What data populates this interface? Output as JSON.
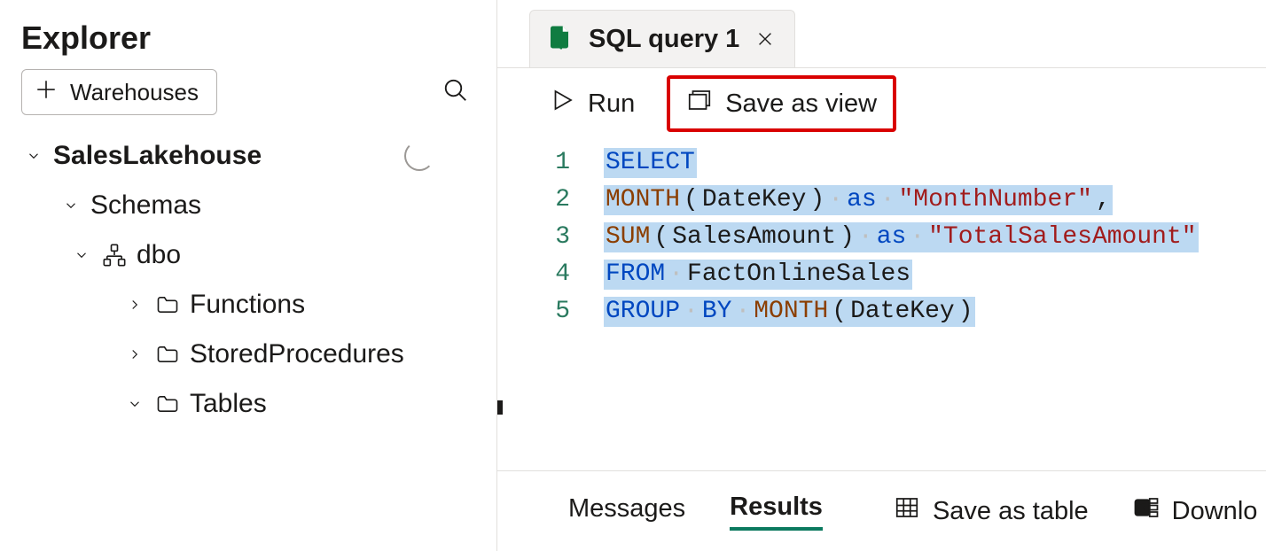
{
  "sidebar": {
    "title": "Explorer",
    "add_button_label": "Warehouses",
    "tree": {
      "db_name": "SalesLakehouse",
      "schemas_label": "Schemas",
      "dbo_label": "dbo",
      "functions_label": "Functions",
      "sprocs_label": "StoredProcedures",
      "tables_label": "Tables"
    }
  },
  "tab": {
    "label": "SQL query 1"
  },
  "toolbar": {
    "run_label": "Run",
    "save_view_label": "Save as view"
  },
  "editor": {
    "line_numbers": [
      "1",
      "2",
      "3",
      "4",
      "5"
    ],
    "tokens": [
      [
        {
          "t": "SELECT",
          "c": "kw",
          "sel": true
        }
      ],
      [
        {
          "t": "MONTH",
          "c": "fn",
          "sel": true
        },
        {
          "t": "(",
          "c": "punc",
          "sel": true
        },
        {
          "t": "DateKey",
          "c": "id",
          "sel": true
        },
        {
          "t": ")",
          "c": "punc",
          "sel": true
        },
        {
          "t": " ",
          "c": "hl",
          "sel": true
        },
        {
          "t": "as",
          "c": "kw",
          "sel": true
        },
        {
          "t": " ",
          "c": "hl",
          "sel": true
        },
        {
          "t": "\"MonthNumber\"",
          "c": "str",
          "sel": true
        },
        {
          "t": ",",
          "c": "punc",
          "sel": true
        }
      ],
      [
        {
          "t": "SUM",
          "c": "fn",
          "sel": true
        },
        {
          "t": "(",
          "c": "punc",
          "sel": true
        },
        {
          "t": "SalesAmount",
          "c": "id",
          "sel": true
        },
        {
          "t": ")",
          "c": "punc",
          "sel": true
        },
        {
          "t": " ",
          "c": "hl",
          "sel": true
        },
        {
          "t": "as",
          "c": "kw",
          "sel": true
        },
        {
          "t": " ",
          "c": "hl",
          "sel": true
        },
        {
          "t": "\"TotalSalesAmount\"",
          "c": "str",
          "sel": true
        }
      ],
      [
        {
          "t": "FROM",
          "c": "kw",
          "sel": true
        },
        {
          "t": " ",
          "c": "hl",
          "sel": true
        },
        {
          "t": "FactOnlineSales",
          "c": "id",
          "sel": true
        }
      ],
      [
        {
          "t": "GROUP",
          "c": "kw",
          "sel": true
        },
        {
          "t": " ",
          "c": "hl",
          "sel": true
        },
        {
          "t": "BY",
          "c": "kw",
          "sel": true
        },
        {
          "t": " ",
          "c": "hl",
          "sel": true
        },
        {
          "t": "MONTH",
          "c": "fn",
          "sel": true
        },
        {
          "t": "(",
          "c": "punc",
          "sel": true
        },
        {
          "t": "DateKey",
          "c": "id",
          "sel": true
        },
        {
          "t": ")",
          "c": "punc",
          "sel": true
        }
      ]
    ]
  },
  "results": {
    "messages_label": "Messages",
    "results_label": "Results",
    "save_table_label": "Save as table",
    "download_label": "Downlo"
  }
}
